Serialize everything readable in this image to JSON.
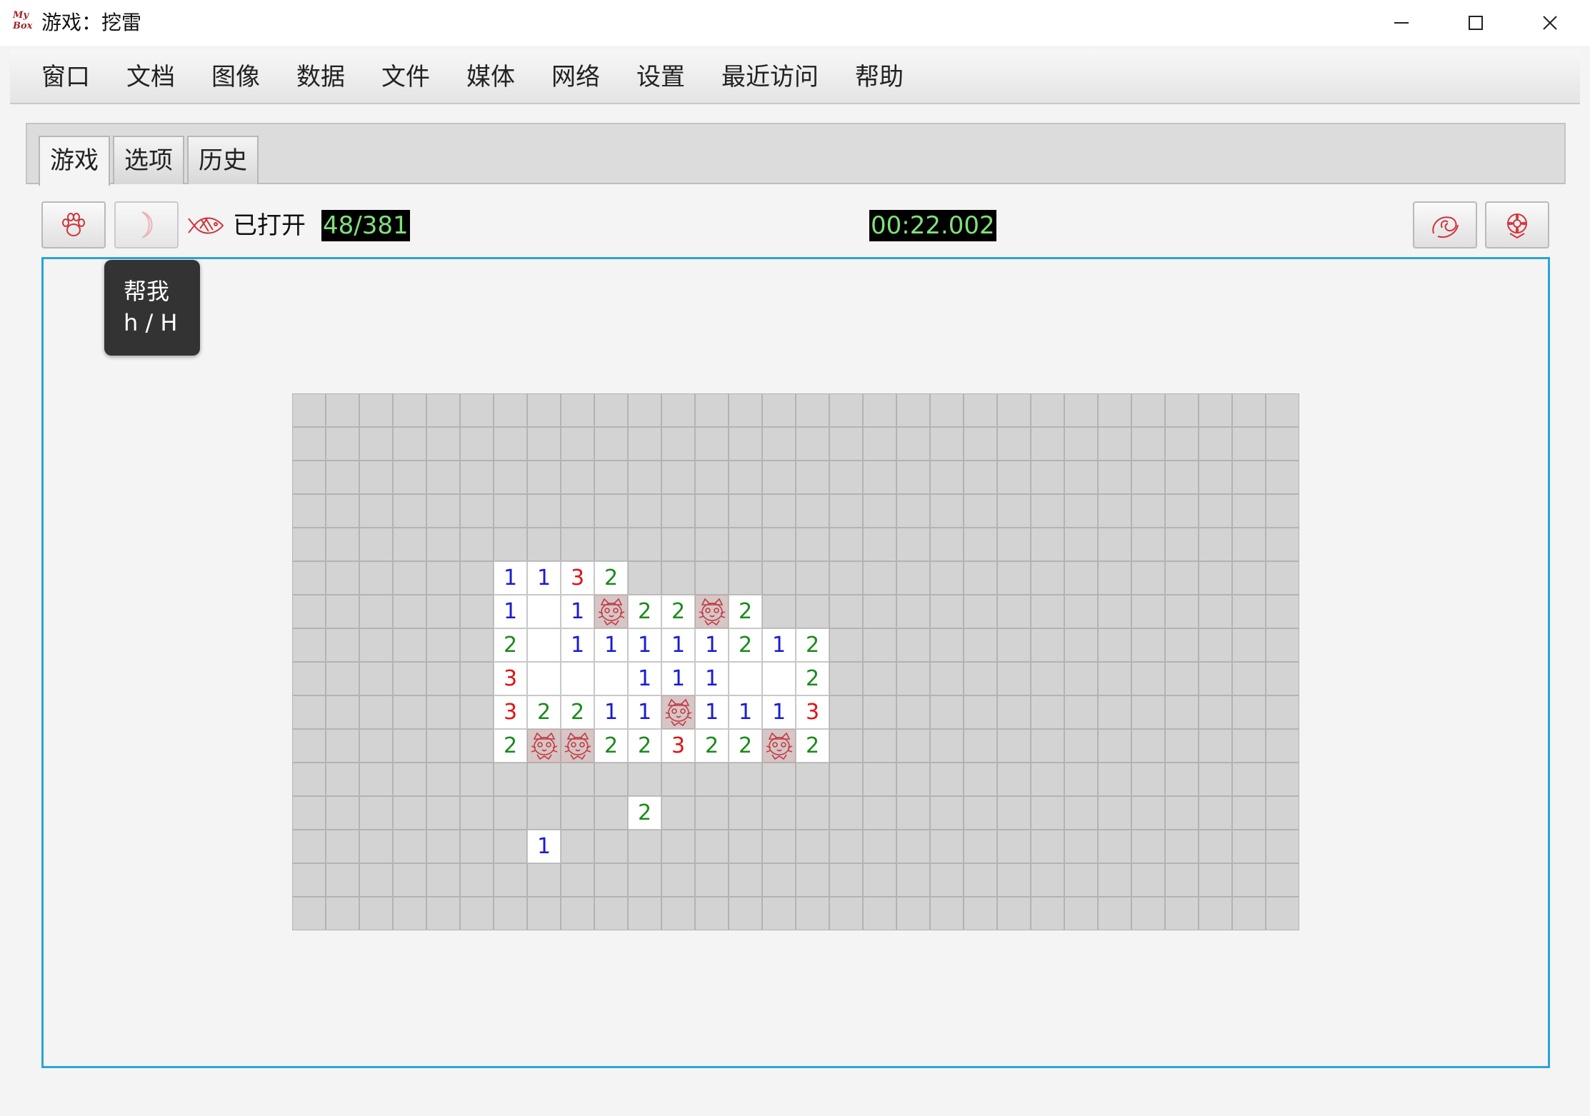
{
  "window": {
    "logo_text": "My Box",
    "title": "游戏：挖雷"
  },
  "menu": [
    "窗口",
    "文档",
    "图像",
    "数据",
    "文件",
    "媒体",
    "网络",
    "设置",
    "最近访问",
    "帮助"
  ],
  "tabs": [
    {
      "label": "游戏",
      "active": true
    },
    {
      "label": "选项",
      "active": false
    },
    {
      "label": "历史",
      "active": false
    }
  ],
  "toolbar": {
    "help_button_icon": "paw-icon",
    "moon_button_icon": "moon-icon",
    "opened_icon": "fish-icon",
    "opened_label": "已打开",
    "opened_count": "48/381",
    "timer": "00:22.002",
    "swirl_button_icon": "swirl-icon",
    "flower_button_icon": "flower-icon"
  },
  "tooltip": {
    "line1": "帮我",
    "line2": "h / H"
  },
  "board": {
    "cols": 30,
    "rows": 16,
    "colors": {
      "1": "#1a1ad6",
      "2": "#1a8a1a",
      "3": "#e01414"
    },
    "mine_icon": "cat-face-icon",
    "cells": [
      {
        "r": 5,
        "c": 6,
        "v": "1"
      },
      {
        "r": 5,
        "c": 7,
        "v": "1"
      },
      {
        "r": 5,
        "c": 8,
        "v": "3"
      },
      {
        "r": 5,
        "c": 9,
        "v": "2"
      },
      {
        "r": 6,
        "c": 6,
        "v": "1"
      },
      {
        "r": 6,
        "c": 7,
        "v": ""
      },
      {
        "r": 6,
        "c": 8,
        "v": "1"
      },
      {
        "r": 6,
        "c": 9,
        "v": "M"
      },
      {
        "r": 6,
        "c": 10,
        "v": "2"
      },
      {
        "r": 6,
        "c": 11,
        "v": "2"
      },
      {
        "r": 6,
        "c": 12,
        "v": "M"
      },
      {
        "r": 6,
        "c": 13,
        "v": "2"
      },
      {
        "r": 7,
        "c": 6,
        "v": "2"
      },
      {
        "r": 7,
        "c": 7,
        "v": ""
      },
      {
        "r": 7,
        "c": 8,
        "v": "1"
      },
      {
        "r": 7,
        "c": 9,
        "v": "1"
      },
      {
        "r": 7,
        "c": 10,
        "v": "1"
      },
      {
        "r": 7,
        "c": 11,
        "v": "1"
      },
      {
        "r": 7,
        "c": 12,
        "v": "1"
      },
      {
        "r": 7,
        "c": 13,
        "v": "2"
      },
      {
        "r": 7,
        "c": 14,
        "v": "1"
      },
      {
        "r": 7,
        "c": 15,
        "v": "2"
      },
      {
        "r": 8,
        "c": 6,
        "v": "3"
      },
      {
        "r": 8,
        "c": 7,
        "v": ""
      },
      {
        "r": 8,
        "c": 8,
        "v": ""
      },
      {
        "r": 8,
        "c": 9,
        "v": ""
      },
      {
        "r": 8,
        "c": 10,
        "v": "1"
      },
      {
        "r": 8,
        "c": 11,
        "v": "1"
      },
      {
        "r": 8,
        "c": 12,
        "v": "1"
      },
      {
        "r": 8,
        "c": 13,
        "v": ""
      },
      {
        "r": 8,
        "c": 14,
        "v": ""
      },
      {
        "r": 8,
        "c": 15,
        "v": "2"
      },
      {
        "r": 9,
        "c": 6,
        "v": "3"
      },
      {
        "r": 9,
        "c": 7,
        "v": "2"
      },
      {
        "r": 9,
        "c": 8,
        "v": "2"
      },
      {
        "r": 9,
        "c": 9,
        "v": "1"
      },
      {
        "r": 9,
        "c": 10,
        "v": "1"
      },
      {
        "r": 9,
        "c": 11,
        "v": "M"
      },
      {
        "r": 9,
        "c": 12,
        "v": "1"
      },
      {
        "r": 9,
        "c": 13,
        "v": "1"
      },
      {
        "r": 9,
        "c": 14,
        "v": "1"
      },
      {
        "r": 9,
        "c": 15,
        "v": "3"
      },
      {
        "r": 10,
        "c": 6,
        "v": "2"
      },
      {
        "r": 10,
        "c": 7,
        "v": "M"
      },
      {
        "r": 10,
        "c": 8,
        "v": "M"
      },
      {
        "r": 10,
        "c": 9,
        "v": "2"
      },
      {
        "r": 10,
        "c": 10,
        "v": "2"
      },
      {
        "r": 10,
        "c": 11,
        "v": "3"
      },
      {
        "r": 10,
        "c": 12,
        "v": "2"
      },
      {
        "r": 10,
        "c": 13,
        "v": "2"
      },
      {
        "r": 10,
        "c": 14,
        "v": "M"
      },
      {
        "r": 10,
        "c": 15,
        "v": "2"
      },
      {
        "r": 12,
        "c": 10,
        "v": "2"
      },
      {
        "r": 13,
        "c": 7,
        "v": "1"
      }
    ]
  }
}
